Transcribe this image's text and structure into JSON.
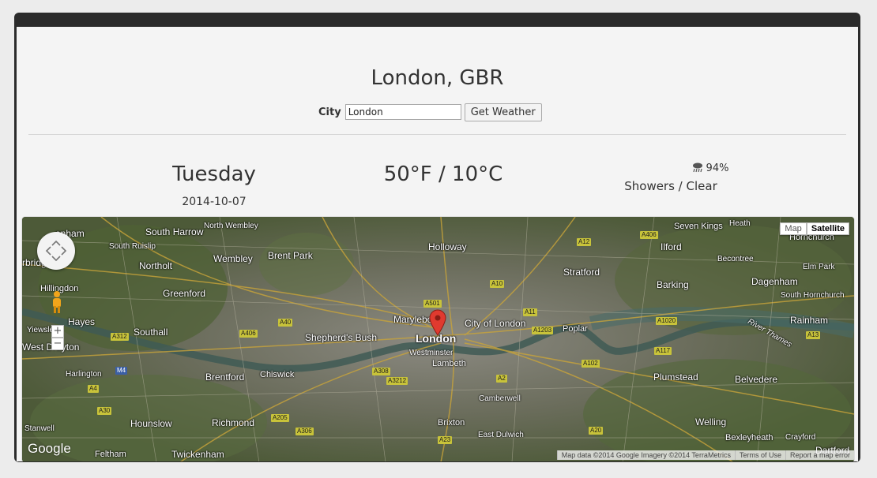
{
  "header": {
    "title": "London, GBR"
  },
  "search": {
    "label": "City",
    "value": "London",
    "button": "Get Weather"
  },
  "forecast": {
    "day": "Tuesday",
    "date": "2014-10-07",
    "temperature": "50°F / 10°C",
    "precip_icon": "rain-cloud-icon",
    "precip": "94%",
    "conditions": "Showers / Clear"
  },
  "map": {
    "type_buttons": {
      "map": "Map",
      "satellite": "Satellite"
    },
    "active_type": "Satellite",
    "logo": "Google",
    "attribution": {
      "data": "Map data ©2014 Google Imagery ©2014 TerraMetrics",
      "terms": "Terms of Use",
      "report": "Report a map error"
    },
    "zoom_in": "+",
    "zoom_out": "−",
    "places": [
      "enham",
      "South Harrow",
      "North Wembley",
      "South Ruislip",
      "Wembley",
      "Brent Park",
      "Holloway",
      "Seven Kings",
      "Heath",
      "Ilford",
      "Hornchurch",
      "rbridge",
      "Northolt",
      "Becontree",
      "Elm Park",
      "Stratford",
      "Hillingdon",
      "Greenford",
      "Barking",
      "Dagenham",
      "South Hornchurch",
      "Hayes",
      "Marylebone",
      "City of London",
      "Poplar",
      "Rainham",
      "Yiewsley",
      "Southall",
      "Shepherd's Bush",
      "London",
      "Westminster",
      "West Drayton",
      "Lambeth",
      "Harlington",
      "Brentford",
      "Chiswick",
      "Plumstead",
      "Belvedere",
      "Camberwell",
      "Hounslow",
      "Richmond",
      "Brixton",
      "Welling",
      "Stanwell",
      "East Dulwich",
      "Bexleyheath",
      "Crayford",
      "Feltham",
      "Twickenham",
      "Dartford",
      "River Thames"
    ],
    "roads": [
      "A406",
      "A12",
      "A501",
      "A10",
      "A40",
      "A11",
      "A312",
      "A406",
      "A1203",
      "A1020",
      "A117",
      "A102",
      "M4",
      "A4",
      "A308",
      "A3212",
      "A2",
      "A30",
      "A205",
      "A306",
      "A23",
      "A20",
      "A13"
    ]
  },
  "colors": {
    "frame": "#2b2b2b",
    "page": "#f4f4f4",
    "marker": "#e03a2f"
  }
}
